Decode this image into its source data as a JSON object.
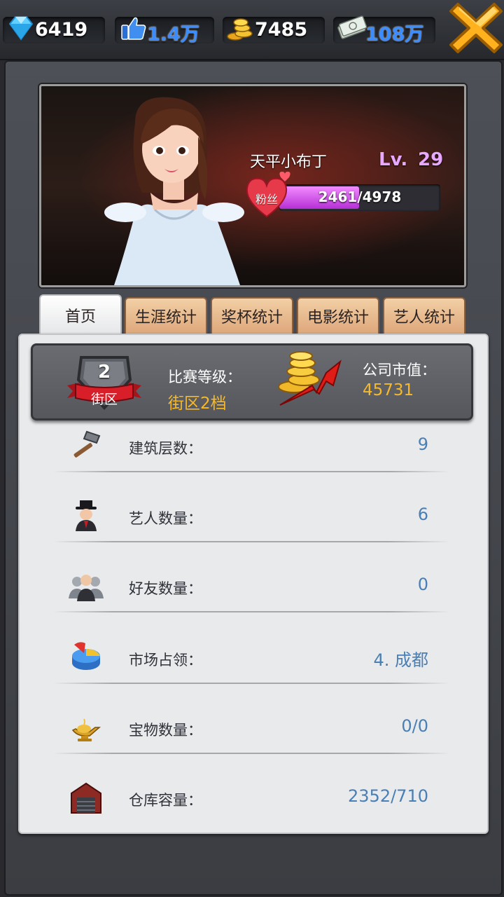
{
  "resources": [
    {
      "icon": "diamond-icon",
      "value": "6419"
    },
    {
      "icon": "thumbs-up-icon",
      "value": "1.4万"
    },
    {
      "icon": "gold-coins-icon",
      "value": "7485"
    },
    {
      "icon": "cash-icon",
      "value": "108万"
    }
  ],
  "profile": {
    "name": "天平小布丁",
    "level_label": "Lv.",
    "level": "29",
    "fans_label": "粉丝",
    "fans_text": "2461/4978",
    "fans_progress": 0.494
  },
  "tabs": [
    "首页",
    "生涯统计",
    "奖杯统计",
    "电影统计",
    "艺人统计"
  ],
  "active_tab": 0,
  "summary": {
    "badge_number": "2",
    "badge_label": "街区",
    "rank_title": "比赛等级：",
    "rank_value": "街区2档",
    "market_title": "公司市值：",
    "market_value": "45731"
  },
  "stats": [
    {
      "icon": "hammer-icon",
      "label": "建筑层数：",
      "value": "9"
    },
    {
      "icon": "agent-icon",
      "label": "艺人数量：",
      "value": "6"
    },
    {
      "icon": "friends-icon",
      "label": "好友数量：",
      "value": "0"
    },
    {
      "icon": "pie-chart-icon",
      "label": "市场占领：",
      "value": "4. 成都"
    },
    {
      "icon": "magic-lamp-icon",
      "label": "宝物数量：",
      "value": "0/0"
    },
    {
      "icon": "warehouse-icon",
      "label": "仓库容量：",
      "value": "2352/710"
    }
  ],
  "colors": {
    "accent_gold": "#f5b92c",
    "stat_value_blue": "#4a7fb5",
    "fan_bar": "#c84ce6",
    "level": "#e8a8ff"
  }
}
